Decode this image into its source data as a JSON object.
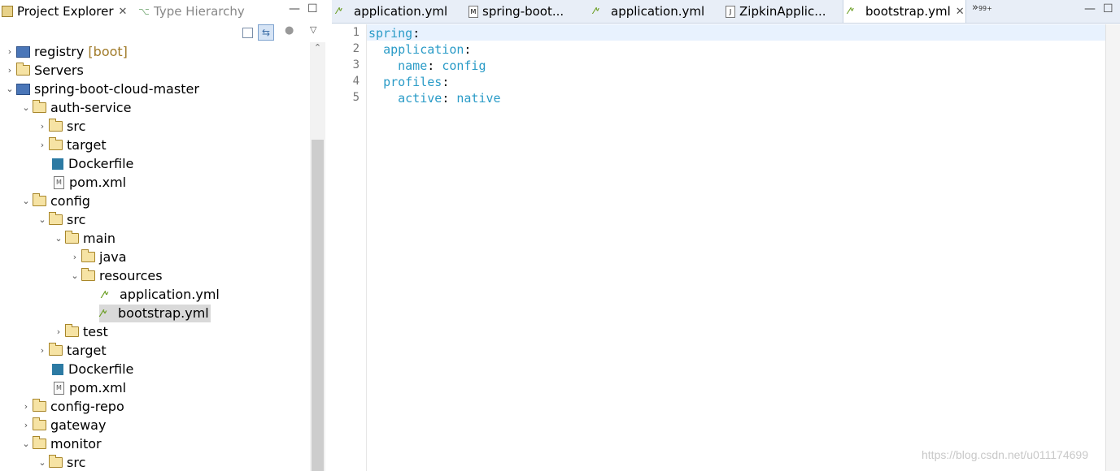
{
  "left_panel": {
    "tab_project_explorer": "Project Explorer",
    "tab_type_hierarchy": "Type Hierarchy",
    "tree": [
      {
        "label": "registry",
        "suffix": "[boot]"
      },
      {
        "label": "Servers"
      },
      {
        "label": "spring-boot-cloud-master"
      },
      {
        "label": "auth-service"
      },
      {
        "label": "src"
      },
      {
        "label": "target"
      },
      {
        "label": "Dockerfile"
      },
      {
        "label": "pom.xml"
      },
      {
        "label": "config"
      },
      {
        "label": "src"
      },
      {
        "label": "main"
      },
      {
        "label": "java"
      },
      {
        "label": "resources"
      },
      {
        "label": "application.yml"
      },
      {
        "label": "bootstrap.yml"
      },
      {
        "label": "test"
      },
      {
        "label": "target"
      },
      {
        "label": "Dockerfile"
      },
      {
        "label": "pom.xml"
      },
      {
        "label": "config-repo"
      },
      {
        "label": "gateway"
      },
      {
        "label": "monitor"
      },
      {
        "label": "src"
      }
    ]
  },
  "editor": {
    "tabs": [
      {
        "label": "application.yml"
      },
      {
        "label": "spring-boot..."
      },
      {
        "label": "application.yml"
      },
      {
        "label": "ZipkinApplic..."
      },
      {
        "label": "bootstrap.yml"
      }
    ],
    "overflow_label": "»",
    "overflow_count": "99+",
    "line_numbers": [
      "1",
      "2",
      "3",
      "4",
      "5"
    ],
    "code": [
      {
        "key": "spring",
        "sep": ":",
        "value": ""
      },
      {
        "key": "application",
        "sep": ":",
        "value": ""
      },
      {
        "key": "name",
        "sep": ": ",
        "value": "config"
      },
      {
        "key": "profiles",
        "sep": ":",
        "value": ""
      },
      {
        "key": "active",
        "sep": ": ",
        "value": "native"
      }
    ],
    "watermark": "https://blog.csdn.net/u011174699"
  }
}
